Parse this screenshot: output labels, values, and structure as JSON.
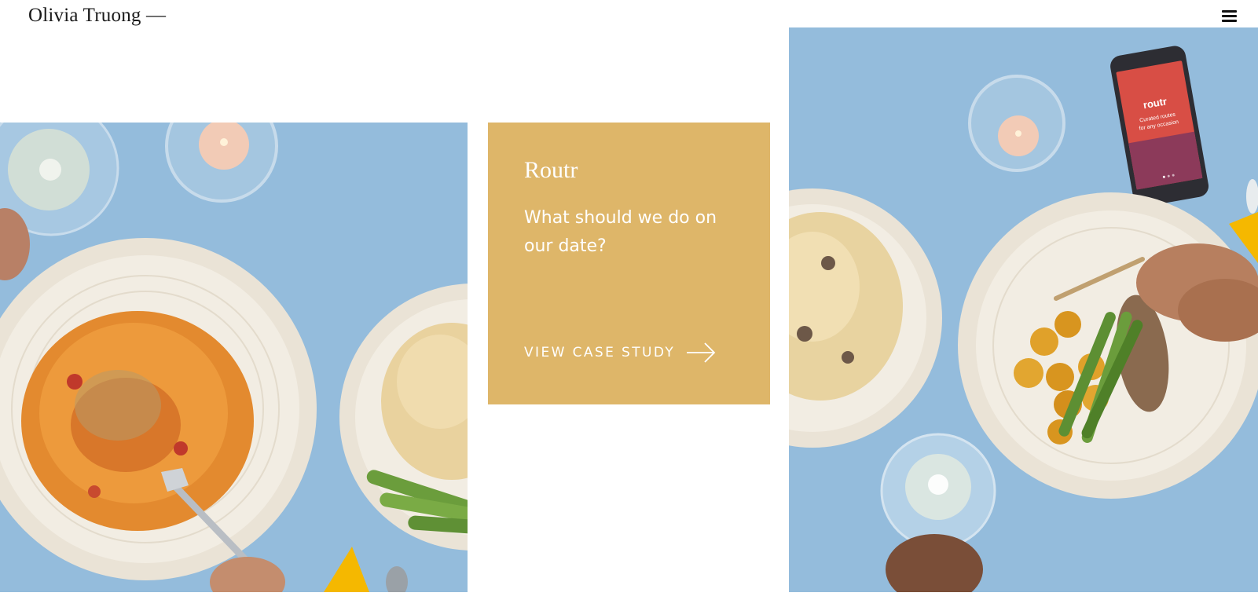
{
  "header": {
    "logo_text": "Olivia Truong —",
    "menu_icon": "hamburger-menu-icon"
  },
  "project": {
    "title": "Routr",
    "description": "What should we do on our date?",
    "cta_label": "VIEW CASE STUDY",
    "cta_icon": "arrow-right-icon",
    "accent_color": "#deb669"
  },
  "phone_screen": {
    "app_name": "routr",
    "tagline_line1": "Curated routes",
    "tagline_line2": "for any occasion"
  },
  "colors": {
    "table_blue": "#94bcdc",
    "plate": "#f1ebe0"
  }
}
